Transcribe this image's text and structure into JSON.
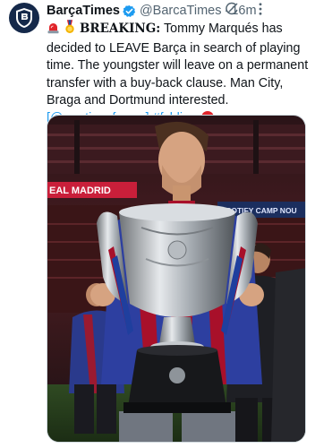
{
  "tweet": {
    "author_name": "BarçaTimes",
    "handle": "@BarcaTimes",
    "separator": "·",
    "time": "16m",
    "text_prefix": "BREAKING:",
    "text_line": " Tommy Marqués has decided to LEAVE Barça in search of playing time. The youngster will leave on a permanent transfer with a buy-back clause. Man City, Braga and Dortmund interested.",
    "mention": "@martinezferran",
    "hashtag": "#fcblive",
    "emojis": [
      "siren-emoji",
      "medal-emoji",
      "red-circle-emoji"
    ]
  },
  "media": {
    "banner_left": "EAL MADRID",
    "banner_right": "SPOTIFY CAMP NOU",
    "description_icons": [
      "trophy",
      "stadium"
    ]
  },
  "colors": {
    "link": "#1d9bf0",
    "text": "#0f1419",
    "muted": "#536471",
    "verified": "#1d9bf0",
    "accent_red": "#e0242a"
  }
}
